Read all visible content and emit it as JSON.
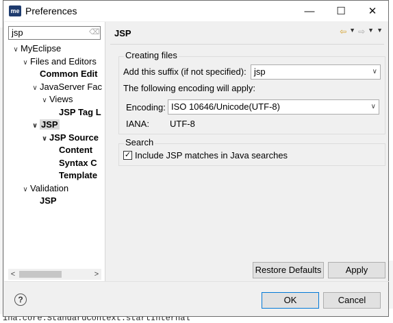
{
  "window": {
    "app_icon_text": "me",
    "title": "Preferences",
    "minimize_glyph": "—",
    "maximize_glyph": "☐",
    "close_glyph": "✕"
  },
  "left": {
    "filter_value": "jsp",
    "clear_glyph": "⌫",
    "tree": [
      {
        "label": "MyEclipse",
        "arrow": "v",
        "bold": false,
        "selected": false
      },
      {
        "label": "Files and Editors",
        "arrow": "v",
        "bold": false,
        "selected": false
      },
      {
        "label": "Common Edit",
        "arrow": "",
        "bold": true,
        "selected": false
      },
      {
        "label": "JavaServer Fac",
        "arrow": "v",
        "bold": false,
        "selected": false
      },
      {
        "label": "Views",
        "arrow": "v",
        "bold": false,
        "selected": false
      },
      {
        "label": "JSP Tag L",
        "arrow": "",
        "bold": true,
        "selected": false
      },
      {
        "label": "JSP",
        "arrow": "v",
        "bold": true,
        "selected": true
      },
      {
        "label": "JSP Source",
        "arrow": "v",
        "bold": true,
        "selected": false
      },
      {
        "label": "Content",
        "arrow": "",
        "bold": true,
        "selected": false
      },
      {
        "label": "Syntax C",
        "arrow": "",
        "bold": true,
        "selected": false
      },
      {
        "label": "Template",
        "arrow": "",
        "bold": true,
        "selected": false
      },
      {
        "label": "Validation",
        "arrow": "v",
        "bold": false,
        "selected": false
      },
      {
        "label": "JSP",
        "arrow": "",
        "bold": true,
        "selected": false
      }
    ],
    "scroll_left": "<",
    "scroll_right": ">"
  },
  "right": {
    "title": "JSP",
    "creating_files": {
      "title": "Creating files",
      "suffix_label": "Add this suffix (if not specified):",
      "suffix_value": "jsp",
      "encoding_note": "The following encoding will apply:",
      "encoding_label": "Encoding:",
      "encoding_value": "ISO 10646/Unicode(UTF-8)",
      "iana_label": "IANA:",
      "iana_value": "UTF-8"
    },
    "search": {
      "title": "Search",
      "checkbox_label": "Include JSP matches in Java searches",
      "checked": true
    },
    "restore_defaults": "Restore Defaults",
    "apply": "Apply"
  },
  "footer": {
    "help": "?",
    "ok": "OK",
    "cancel": "Cancel"
  },
  "background": {
    "console_text": "ina.core.StandardContext.startInternal"
  },
  "colors": {
    "dialog_bg": "#f0f0f0",
    "accent_button_border": "#0078d7",
    "back_arrow": "#d4a02a"
  }
}
